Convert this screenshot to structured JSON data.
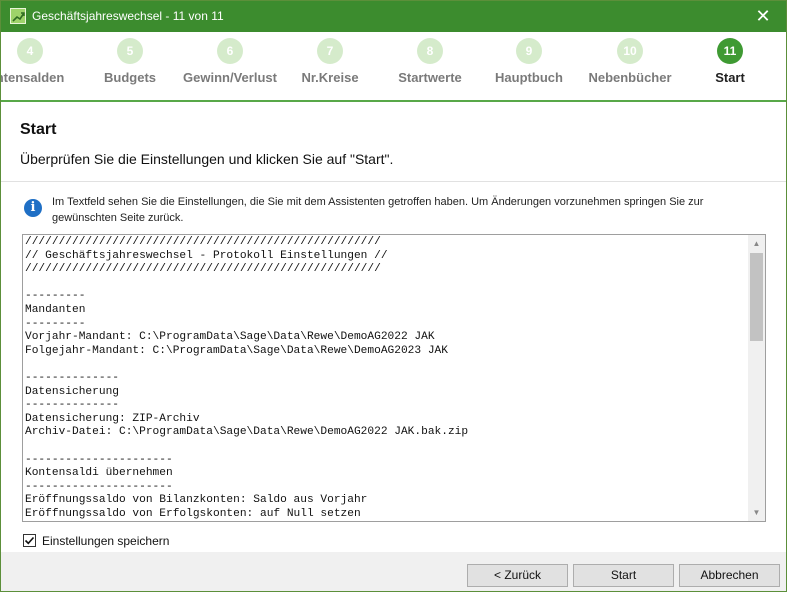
{
  "window": {
    "title": "Geschäftsjahreswechsel - 11 von 11",
    "close_glyph": "✕",
    "accent_color": "#3c8c2e"
  },
  "steps": [
    {
      "number": "4",
      "label": "Kontensalden",
      "display": "ntensalden",
      "state": "pending"
    },
    {
      "number": "5",
      "label": "Budgets",
      "state": "pending"
    },
    {
      "number": "6",
      "label": "Gewinn/Verlust",
      "state": "pending"
    },
    {
      "number": "7",
      "label": "Nr.Kreise",
      "state": "pending"
    },
    {
      "number": "8",
      "label": "Startwerte",
      "state": "pending"
    },
    {
      "number": "9",
      "label": "Hauptbuch",
      "state": "pending"
    },
    {
      "number": "10",
      "label": "Nebenbücher",
      "state": "pending"
    },
    {
      "number": "11",
      "label": "Start",
      "state": "active"
    }
  ],
  "page": {
    "heading": "Start",
    "subheading": "Überprüfen Sie die Einstellungen und klicken Sie auf \"Start\".",
    "info_icon": "info-icon",
    "info_text": "Im Textfeld sehen Sie die Einstellungen, die Sie mit dem Assistenten getroffen haben. Um Änderungen vorzunehmen springen Sie zur gewünschten Seite zurück."
  },
  "log": {
    "lines": [
      "/////////////////////////////////////////////////////",
      "// Geschäftsjahreswechsel - Protokoll Einstellungen //",
      "/////////////////////////////////////////////////////",
      "",
      "---------",
      "Mandanten",
      "---------",
      "Vorjahr-Mandant: C:\\ProgramData\\Sage\\Data\\Rewe\\DemoAG2022 JAK",
      "Folgejahr-Mandant: C:\\ProgramData\\Sage\\Data\\Rewe\\DemoAG2023 JAK",
      "",
      "--------------",
      "Datensicherung",
      "--------------",
      "Datensicherung: ZIP-Archiv",
      "Archiv-Datei: C:\\ProgramData\\Sage\\Data\\Rewe\\DemoAG2022 JAK.bak.zip",
      "",
      "----------------------",
      "Kontensaldi übernehmen",
      "----------------------",
      "Eröffnungssaldo von Bilanzkonten: Saldo aus Vorjahr",
      "Eröffnungssaldo von Erfolgskonten: auf Null setzen"
    ]
  },
  "options": {
    "save_settings_label": "Einstellungen speichern",
    "save_settings_checked": true
  },
  "buttons": {
    "back": "< Zurück",
    "start": "Start",
    "cancel": "Abbrechen"
  }
}
